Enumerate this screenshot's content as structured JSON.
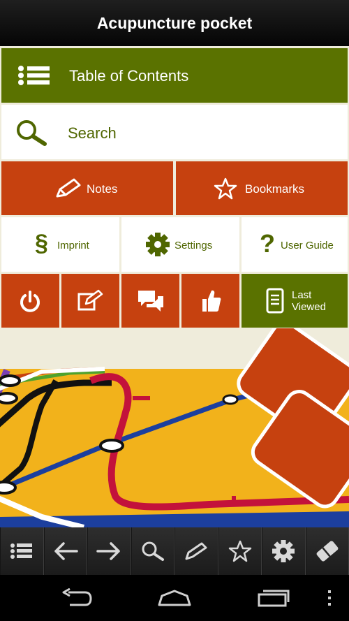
{
  "app": {
    "title": "Acupuncture pocket"
  },
  "menu": {
    "toc_label": "Table of Contents",
    "search_label": "Search",
    "notes_label": "Notes",
    "bookmarks_label": "Bookmarks",
    "imprint_label": "Imprint",
    "settings_label": "Settings",
    "user_guide_label": "User Guide",
    "last_viewed_line1": "Last",
    "last_viewed_line2": "Viewed"
  },
  "colors": {
    "green": "#5a7200",
    "orange": "#c6410f",
    "cream": "#efecdb",
    "map_yellow": "#f2b21b"
  },
  "icons": {
    "toc": "list-icon",
    "search": "magnifier-icon",
    "notes": "pencil-icon",
    "bookmarks": "star-icon",
    "imprint": "section-sign-icon",
    "settings": "gear-icon",
    "user_guide": "question-mark-icon",
    "power": "power-icon",
    "edit": "edit-note-icon",
    "chat": "chat-bubbles-icon",
    "like": "thumbs-up-icon",
    "last_viewed": "document-icon"
  },
  "toolbar": [
    "list-icon",
    "arrow-left-icon",
    "arrow-right-icon",
    "search-icon",
    "pencil-icon",
    "star-icon",
    "gear-icon",
    "eraser-icon"
  ],
  "navbar": [
    "back-icon",
    "home-icon",
    "recent-apps-icon",
    "overflow-menu-icon"
  ]
}
